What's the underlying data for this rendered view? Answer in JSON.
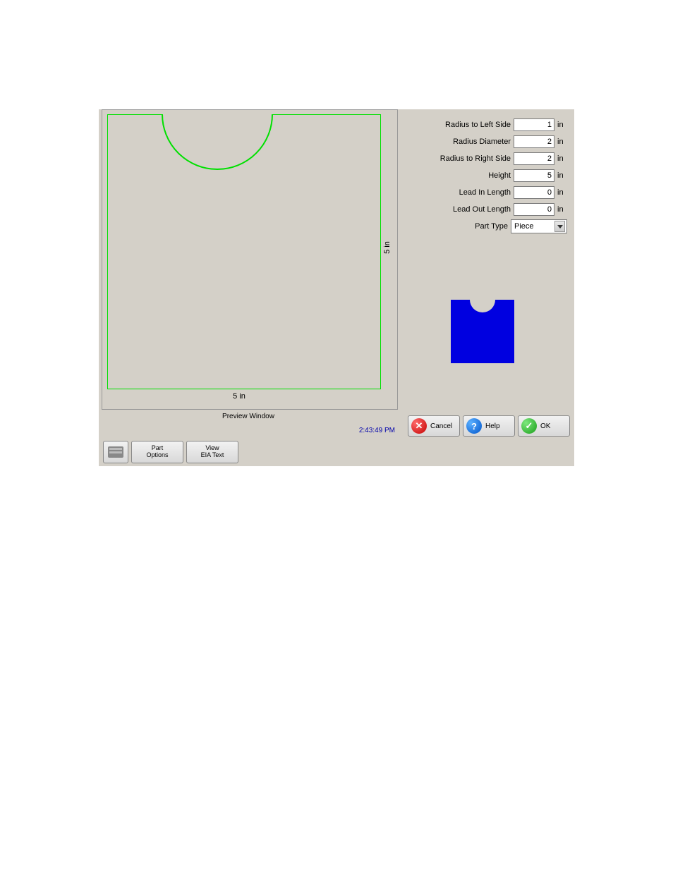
{
  "preview": {
    "label": "Preview Window",
    "dim_x": "5 in",
    "dim_y": "5 in"
  },
  "timestamp": "2:43:49 PM",
  "params": {
    "radius_left": {
      "label": "Radius to Left Side",
      "value": "1",
      "unit": "in"
    },
    "radius_diameter": {
      "label": "Radius Diameter",
      "value": "2",
      "unit": "in"
    },
    "radius_right": {
      "label": "Radius to Right Side",
      "value": "2",
      "unit": "in"
    },
    "height": {
      "label": "Height",
      "value": "5",
      "unit": "in"
    },
    "lead_in": {
      "label": "Lead In Length",
      "value": "0",
      "unit": "in"
    },
    "lead_out": {
      "label": "Lead Out Length",
      "value": "0",
      "unit": "in"
    },
    "part_type": {
      "label": "Part Type",
      "value": "Piece"
    }
  },
  "actions": {
    "cancel": "Cancel",
    "help": "Help",
    "ok": "OK"
  },
  "bottom": {
    "part_options": "Part\nOptions",
    "view_eia": "View\nEIA Text"
  }
}
